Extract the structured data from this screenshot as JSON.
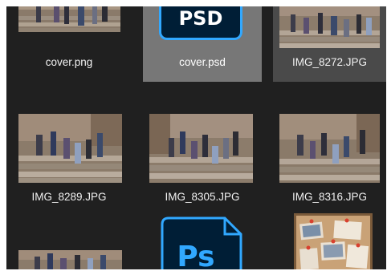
{
  "files": [
    {
      "name": "cover.png",
      "kind": "photo"
    },
    {
      "name": "cover.psd",
      "kind": "psd-icon",
      "badge_text": "PSD",
      "selected": true
    },
    {
      "name": "IMG_8272.JPG",
      "kind": "photo",
      "hovered": true
    },
    {
      "name": "IMG_8289.JPG",
      "kind": "photo"
    },
    {
      "name": "IMG_8305.JPG",
      "kind": "photo"
    },
    {
      "name": "IMG_8316.JPG",
      "kind": "photo"
    },
    {
      "name": "",
      "kind": "photo"
    },
    {
      "name": "",
      "kind": "ps-icon",
      "badge_text": "Ps"
    },
    {
      "name": "",
      "kind": "corkboard"
    }
  ],
  "colors": {
    "pane_background": "#202020",
    "selected_tile": "#777777",
    "hovered_tile": "#4a4a4a",
    "ps_dark": "#001e36",
    "ps_blue": "#31a8ff"
  }
}
